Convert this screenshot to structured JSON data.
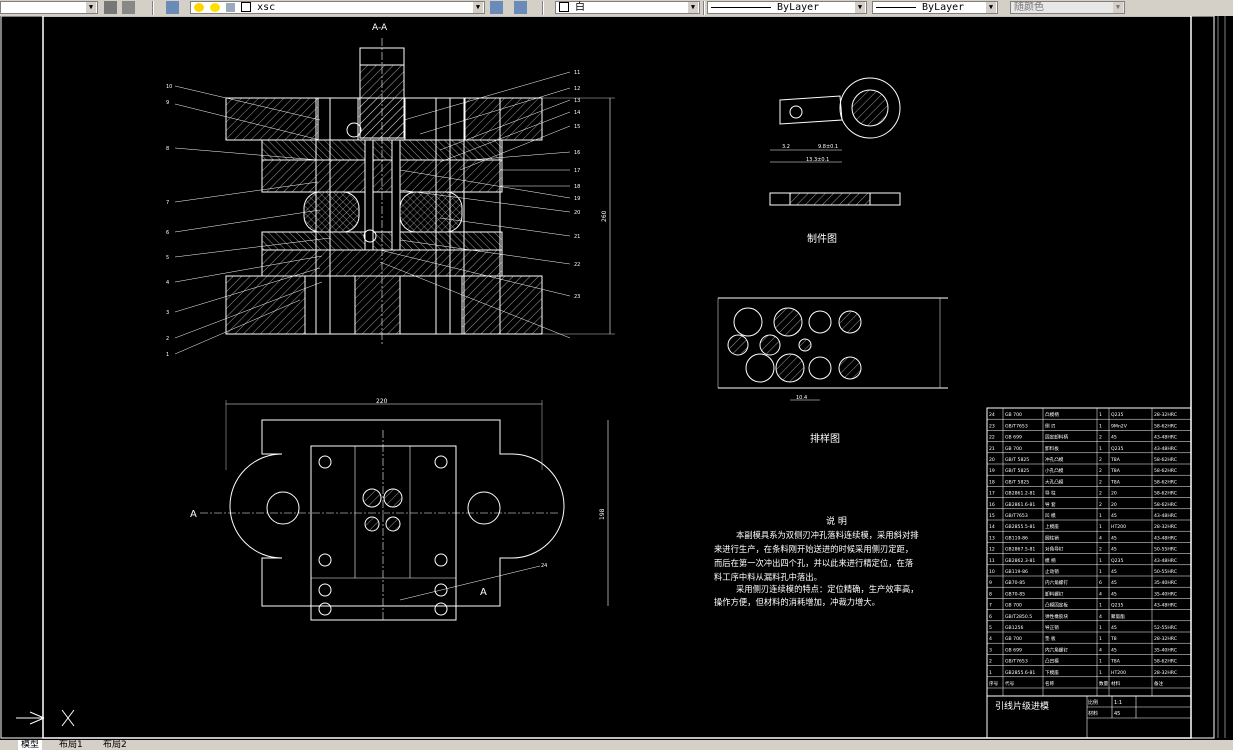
{
  "toolbar": {
    "layer_name": "xsc",
    "color": "白",
    "linetype": "ByLayer",
    "lineweight": "ByLayer",
    "plotstyle": "随颜色"
  },
  "drawing": {
    "section_label": "A-A",
    "cut_label": "A",
    "part_title": "制件图",
    "strip_title": "排样图",
    "notes_title": "说 明",
    "notes": [
      "本副模具系为双侧刃冲孔落料连续模，采用斜对排",
      "来进行生产，在条料刚开始送进的时候采用侧刃定距，",
      "而后在第一次冲出四个孔，并以此来进行精定位，在落",
      "料工序中料从漏料孔中落出。",
      "采用侧刃连续模的特点：定位精确，生产效率高，",
      "操作方便，但材料的消耗增加，冲裁力增大。"
    ],
    "dim_width": "220",
    "dim_height_plan": "198",
    "dim_height_section": "260",
    "dim_part_a": "3.2",
    "dim_part_b": "9.8±0.1",
    "dim_part_c": "13.3±0.1",
    "dim_strip_pitch": "10.4",
    "left_callouts": [
      "10",
      "9",
      "8",
      "7",
      "6",
      "5",
      "4",
      "3",
      "2",
      "1"
    ],
    "right_callouts": [
      "11",
      "12",
      "13",
      "14",
      "15",
      "16",
      "17",
      "18",
      "19",
      "20",
      "21",
      "22",
      "23"
    ],
    "plan_callout": "24"
  },
  "bom": {
    "rows": [
      [
        "24",
        "GB 700",
        "凸模柄",
        "1",
        "Q235",
        "28-32HRC"
      ],
      [
        "23",
        "GB/T7653",
        "侧 刃",
        "1",
        "9Mn2V",
        "58-62HRC"
      ],
      [
        "22",
        "GB 699",
        "固定卸料柄",
        "2",
        "45",
        "43-48HRC"
      ],
      [
        "21",
        "GB 700",
        "卸料板",
        "1",
        "Q235",
        "43-48HRC"
      ],
      [
        "20",
        "GB/T 5825",
        "冲孔凸模",
        "2",
        "T8A",
        "58-62HRC"
      ],
      [
        "19",
        "GB/T 5825",
        "小孔凸模",
        "2",
        "T8A",
        "58-62HRC"
      ],
      [
        "18",
        "GB/T 5825",
        "大孔凸模",
        "2",
        "T8A",
        "58-62HRC"
      ],
      [
        "17",
        "GB2861.2-81",
        "导 柱",
        "2",
        "20",
        "58-62HRC"
      ],
      [
        "16",
        "GB2861.6-81",
        "导 套",
        "2",
        "20",
        "58-62HRC"
      ],
      [
        "15",
        "GB/T7653",
        "凹 模",
        "1",
        "45",
        "43-48HRC"
      ],
      [
        "14",
        "GB2855.5-81",
        "上模座",
        "1",
        "HT200",
        "28-32HRC"
      ],
      [
        "13",
        "GB119-86",
        "圆柱销",
        "4",
        "45",
        "43-48HRC"
      ],
      [
        "12",
        "GB2867.5-81",
        "对角导钉",
        "2",
        "45",
        "50-55HRC"
      ],
      [
        "11",
        "GB2862.3-81",
        "模 柄",
        "1",
        "Q235",
        "43-48HRC"
      ],
      [
        "10",
        "GB119-86",
        "止动销",
        "1",
        "45",
        "50-55HRC"
      ],
      [
        "9",
        "GB70-85",
        "内六角螺钉",
        "6",
        "45",
        "35-40HRC"
      ],
      [
        "8",
        "GB70-85",
        "卸料螺钉",
        "4",
        "45",
        "35-40HRC"
      ],
      [
        "7",
        "GB 700",
        "凸模固定板",
        "1",
        "Q235",
        "43-48HRC"
      ],
      [
        "6",
        "GB/T2850.5",
        "弹性橡胶块",
        "4",
        "聚氨酯",
        ""
      ],
      [
        "5",
        "GB1256",
        "导正销",
        "1",
        "45",
        "52-55HRC"
      ],
      [
        "4",
        "GB 700",
        "垫 板",
        "1",
        "T8",
        "28-32HRC"
      ],
      [
        "3",
        "GB 699",
        "内六角螺钉",
        "4",
        "45",
        "35-40HRC"
      ],
      [
        "2",
        "GB/T7653",
        "凸凹模",
        "1",
        "T8A",
        "58-62HRC"
      ],
      [
        "1",
        "GB2855.6-81",
        "下模座",
        "1",
        "HT200",
        "28-32HRC"
      ]
    ],
    "header": [
      "序号",
      "代号",
      "名称",
      "数量",
      "材料",
      "备注"
    ],
    "title": "引线片级进模",
    "scale_label": "比例",
    "scale_value": "1:1",
    "qty_label": "材料",
    "qty_value": "45"
  },
  "tabs": [
    "模型",
    "布局1",
    "布局2"
  ]
}
